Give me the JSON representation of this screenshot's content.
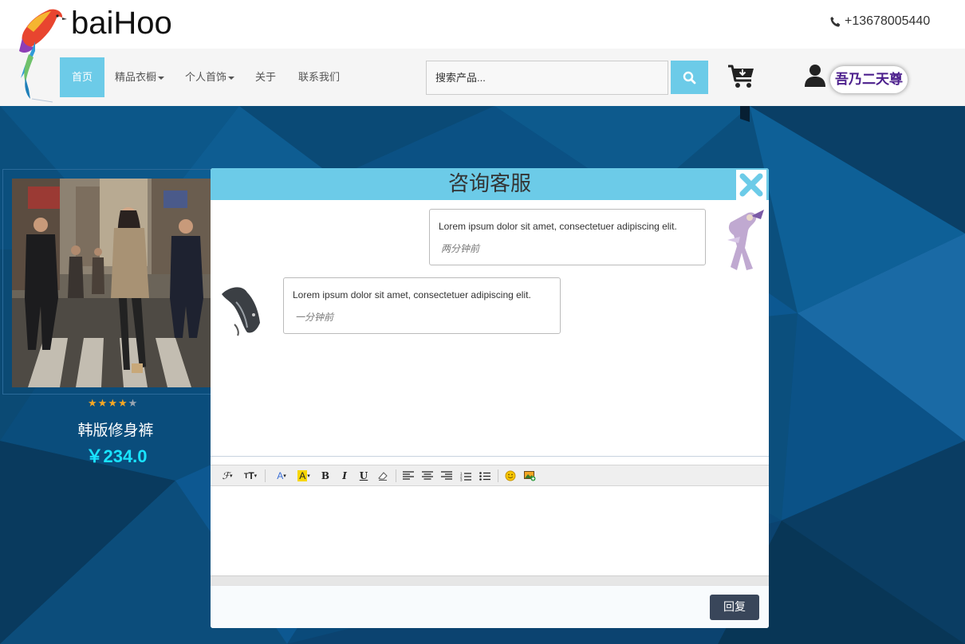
{
  "brand": {
    "name": "baiHoo",
    "phone": "+13678005440"
  },
  "nav": {
    "items": [
      {
        "label": "首页",
        "active": true,
        "dropdown": false
      },
      {
        "label": "精品衣橱",
        "active": false,
        "dropdown": true
      },
      {
        "label": "个人首饰",
        "active": false,
        "dropdown": true
      },
      {
        "label": "关于",
        "active": false,
        "dropdown": false
      },
      {
        "label": "联系我们",
        "active": false,
        "dropdown": false
      }
    ],
    "search_placeholder": "搜索产品...",
    "username": "吾乃二天尊"
  },
  "product": {
    "name": "韩版修身裤",
    "price": "￥234.0",
    "rating": 4,
    "rating_max": 5
  },
  "chat": {
    "title": "咨询客服",
    "messages": [
      {
        "side": "right",
        "text": "Lorem ipsum dolor sit amet, consectetuer adipiscing elit.",
        "time": "两分钟前"
      },
      {
        "side": "left",
        "text": "Lorem ipsum dolor sit amet, consectetuer adipiscing elit.",
        "time": "一分钟前"
      }
    ],
    "toolbar": [
      "font-family",
      "font-size",
      "font-color",
      "highlight-color",
      "bold",
      "italic",
      "underline",
      "eraser",
      "align-left",
      "align-center",
      "align-right",
      "ordered-list",
      "unordered-list",
      "emoticon",
      "insert-image"
    ],
    "reply_label": "回复"
  },
  "colors": {
    "accent": "#6ccbe8",
    "price": "#19e3ff",
    "reply_button": "#39465a",
    "username": "#4b1e8c"
  }
}
